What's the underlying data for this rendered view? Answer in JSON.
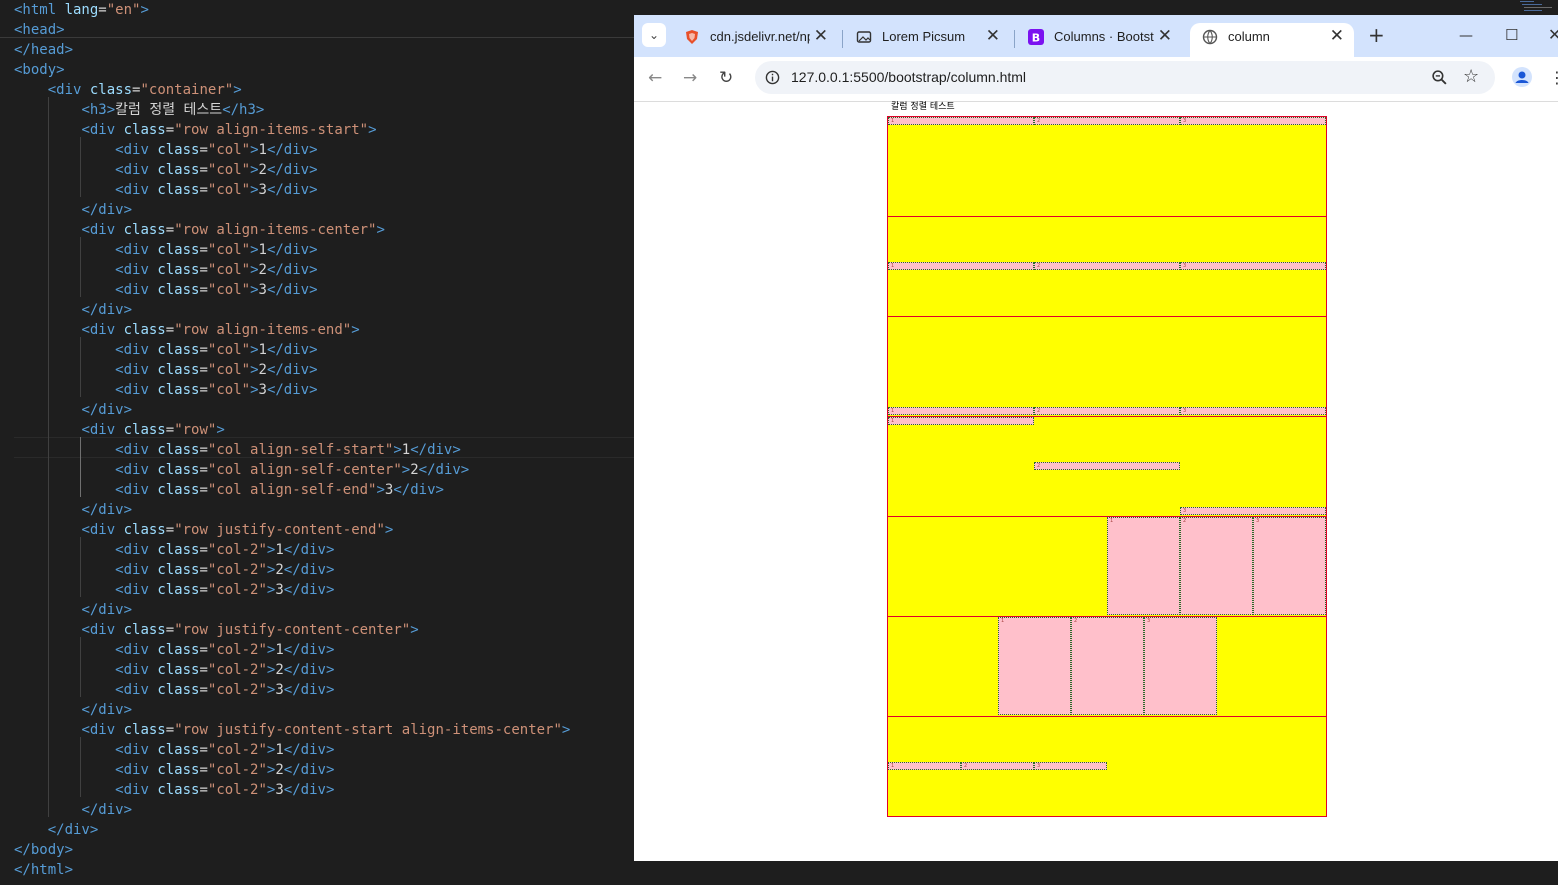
{
  "editor": {
    "lines": [
      [
        [
          "tag",
          "<html "
        ],
        [
          "attr",
          "lang"
        ],
        [
          "txt",
          "="
        ],
        [
          "str",
          "\"en\""
        ],
        [
          "tag",
          ">"
        ]
      ],
      [
        [
          "tag",
          "<head>"
        ]
      ],
      [
        [
          "tag",
          "</head>"
        ]
      ],
      [
        [
          "tag",
          "<body>"
        ]
      ],
      [
        [
          "txt",
          "    "
        ],
        [
          "tag",
          "<div "
        ],
        [
          "attr",
          "class"
        ],
        [
          "txt",
          "="
        ],
        [
          "str",
          "\"container\""
        ],
        [
          "tag",
          ">"
        ]
      ],
      [
        [
          "txt",
          "        "
        ],
        [
          "tag",
          "<h3>"
        ],
        [
          "txt",
          "칼럼 정렬 테스트"
        ],
        [
          "tag",
          "</h3>"
        ]
      ],
      [
        [
          "txt",
          "        "
        ],
        [
          "tag",
          "<div "
        ],
        [
          "attr",
          "class"
        ],
        [
          "txt",
          "="
        ],
        [
          "str",
          "\"row align-items-start\""
        ],
        [
          "tag",
          ">"
        ]
      ],
      [
        [
          "txt",
          "            "
        ],
        [
          "tag",
          "<div "
        ],
        [
          "attr",
          "class"
        ],
        [
          "txt",
          "="
        ],
        [
          "str",
          "\"col\""
        ],
        [
          "tag",
          ">"
        ],
        [
          "txt",
          "1"
        ],
        [
          "tag",
          "</div>"
        ]
      ],
      [
        [
          "txt",
          "            "
        ],
        [
          "tag",
          "<div "
        ],
        [
          "attr",
          "class"
        ],
        [
          "txt",
          "="
        ],
        [
          "str",
          "\"col\""
        ],
        [
          "tag",
          ">"
        ],
        [
          "txt",
          "2"
        ],
        [
          "tag",
          "</div>"
        ]
      ],
      [
        [
          "txt",
          "            "
        ],
        [
          "tag",
          "<div "
        ],
        [
          "attr",
          "class"
        ],
        [
          "txt",
          "="
        ],
        [
          "str",
          "\"col\""
        ],
        [
          "tag",
          ">"
        ],
        [
          "txt",
          "3"
        ],
        [
          "tag",
          "</div>"
        ]
      ],
      [
        [
          "txt",
          "        "
        ],
        [
          "tag",
          "</div>"
        ]
      ],
      [
        [
          "txt",
          "        "
        ],
        [
          "tag",
          "<div "
        ],
        [
          "attr",
          "class"
        ],
        [
          "txt",
          "="
        ],
        [
          "str",
          "\"row align-items-center\""
        ],
        [
          "tag",
          ">"
        ]
      ],
      [
        [
          "txt",
          "            "
        ],
        [
          "tag",
          "<div "
        ],
        [
          "attr",
          "class"
        ],
        [
          "txt",
          "="
        ],
        [
          "str",
          "\"col\""
        ],
        [
          "tag",
          ">"
        ],
        [
          "txt",
          "1"
        ],
        [
          "tag",
          "</div>"
        ]
      ],
      [
        [
          "txt",
          "            "
        ],
        [
          "tag",
          "<div "
        ],
        [
          "attr",
          "class"
        ],
        [
          "txt",
          "="
        ],
        [
          "str",
          "\"col\""
        ],
        [
          "tag",
          ">"
        ],
        [
          "txt",
          "2"
        ],
        [
          "tag",
          "</div>"
        ]
      ],
      [
        [
          "txt",
          "            "
        ],
        [
          "tag",
          "<div "
        ],
        [
          "attr",
          "class"
        ],
        [
          "txt",
          "="
        ],
        [
          "str",
          "\"col\""
        ],
        [
          "tag",
          ">"
        ],
        [
          "txt",
          "3"
        ],
        [
          "tag",
          "</div>"
        ]
      ],
      [
        [
          "txt",
          "        "
        ],
        [
          "tag",
          "</div>"
        ]
      ],
      [
        [
          "txt",
          "        "
        ],
        [
          "tag",
          "<div "
        ],
        [
          "attr",
          "class"
        ],
        [
          "txt",
          "="
        ],
        [
          "str",
          "\"row align-items-end\""
        ],
        [
          "tag",
          ">"
        ]
      ],
      [
        [
          "txt",
          "            "
        ],
        [
          "tag",
          "<div "
        ],
        [
          "attr",
          "class"
        ],
        [
          "txt",
          "="
        ],
        [
          "str",
          "\"col\""
        ],
        [
          "tag",
          ">"
        ],
        [
          "txt",
          "1"
        ],
        [
          "tag",
          "</div>"
        ]
      ],
      [
        [
          "txt",
          "            "
        ],
        [
          "tag",
          "<div "
        ],
        [
          "attr",
          "class"
        ],
        [
          "txt",
          "="
        ],
        [
          "str",
          "\"col\""
        ],
        [
          "tag",
          ">"
        ],
        [
          "txt",
          "2"
        ],
        [
          "tag",
          "</div>"
        ]
      ],
      [
        [
          "txt",
          "            "
        ],
        [
          "tag",
          "<div "
        ],
        [
          "attr",
          "class"
        ],
        [
          "txt",
          "="
        ],
        [
          "str",
          "\"col\""
        ],
        [
          "tag",
          ">"
        ],
        [
          "txt",
          "3"
        ],
        [
          "tag",
          "</div>"
        ]
      ],
      [
        [
          "txt",
          "        "
        ],
        [
          "tag",
          "</div>"
        ]
      ],
      [
        [
          "txt",
          "        "
        ],
        [
          "tag",
          "<div "
        ],
        [
          "attr",
          "class"
        ],
        [
          "txt",
          "="
        ],
        [
          "str",
          "\"row\""
        ],
        [
          "tag",
          ">"
        ]
      ],
      [
        [
          "txt",
          "            "
        ],
        [
          "tag",
          "<div "
        ],
        [
          "attr",
          "class"
        ],
        [
          "txt",
          "="
        ],
        [
          "str",
          "\"col align-self-start\""
        ],
        [
          "tag",
          ">"
        ],
        [
          "txt",
          "1"
        ],
        [
          "tag",
          "</div>"
        ]
      ],
      [
        [
          "txt",
          "            "
        ],
        [
          "tag",
          "<div "
        ],
        [
          "attr",
          "class"
        ],
        [
          "txt",
          "="
        ],
        [
          "str",
          "\"col align-self-center\""
        ],
        [
          "tag",
          ">"
        ],
        [
          "txt",
          "2"
        ],
        [
          "tag",
          "</div>"
        ]
      ],
      [
        [
          "txt",
          "            "
        ],
        [
          "tag",
          "<div "
        ],
        [
          "attr",
          "class"
        ],
        [
          "txt",
          "="
        ],
        [
          "str",
          "\"col align-self-end\""
        ],
        [
          "tag",
          ">"
        ],
        [
          "txt",
          "3"
        ],
        [
          "tag",
          "</div>"
        ]
      ],
      [
        [
          "txt",
          "        "
        ],
        [
          "tag",
          "</div>"
        ]
      ],
      [
        [
          "txt",
          "        "
        ],
        [
          "tag",
          "<div "
        ],
        [
          "attr",
          "class"
        ],
        [
          "txt",
          "="
        ],
        [
          "str",
          "\"row justify-content-end\""
        ],
        [
          "tag",
          ">"
        ]
      ],
      [
        [
          "txt",
          "            "
        ],
        [
          "tag",
          "<div "
        ],
        [
          "attr",
          "class"
        ],
        [
          "txt",
          "="
        ],
        [
          "str",
          "\"col-2\""
        ],
        [
          "tag",
          ">"
        ],
        [
          "txt",
          "1"
        ],
        [
          "tag",
          "</div>"
        ]
      ],
      [
        [
          "txt",
          "            "
        ],
        [
          "tag",
          "<div "
        ],
        [
          "attr",
          "class"
        ],
        [
          "txt",
          "="
        ],
        [
          "str",
          "\"col-2\""
        ],
        [
          "tag",
          ">"
        ],
        [
          "txt",
          "2"
        ],
        [
          "tag",
          "</div>"
        ]
      ],
      [
        [
          "txt",
          "            "
        ],
        [
          "tag",
          "<div "
        ],
        [
          "attr",
          "class"
        ],
        [
          "txt",
          "="
        ],
        [
          "str",
          "\"col-2\""
        ],
        [
          "tag",
          ">"
        ],
        [
          "txt",
          "3"
        ],
        [
          "tag",
          "</div>"
        ]
      ],
      [
        [
          "txt",
          "        "
        ],
        [
          "tag",
          "</div>"
        ]
      ],
      [
        [
          "txt",
          "        "
        ],
        [
          "tag",
          "<div "
        ],
        [
          "attr",
          "class"
        ],
        [
          "txt",
          "="
        ],
        [
          "str",
          "\"row justify-content-center\""
        ],
        [
          "tag",
          ">"
        ]
      ],
      [
        [
          "txt",
          "            "
        ],
        [
          "tag",
          "<div "
        ],
        [
          "attr",
          "class"
        ],
        [
          "txt",
          "="
        ],
        [
          "str",
          "\"col-2\""
        ],
        [
          "tag",
          ">"
        ],
        [
          "txt",
          "1"
        ],
        [
          "tag",
          "</div>"
        ]
      ],
      [
        [
          "txt",
          "            "
        ],
        [
          "tag",
          "<div "
        ],
        [
          "attr",
          "class"
        ],
        [
          "txt",
          "="
        ],
        [
          "str",
          "\"col-2\""
        ],
        [
          "tag",
          ">"
        ],
        [
          "txt",
          "2"
        ],
        [
          "tag",
          "</div>"
        ]
      ],
      [
        [
          "txt",
          "            "
        ],
        [
          "tag",
          "<div "
        ],
        [
          "attr",
          "class"
        ],
        [
          "txt",
          "="
        ],
        [
          "str",
          "\"col-2\""
        ],
        [
          "tag",
          ">"
        ],
        [
          "txt",
          "3"
        ],
        [
          "tag",
          "</div>"
        ]
      ],
      [
        [
          "txt",
          "        "
        ],
        [
          "tag",
          "</div>"
        ]
      ],
      [
        [
          "txt",
          "        "
        ],
        [
          "tag",
          "<div "
        ],
        [
          "attr",
          "class"
        ],
        [
          "txt",
          "="
        ],
        [
          "str",
          "\"row justify-content-start align-items-center\""
        ],
        [
          "tag",
          ">"
        ]
      ],
      [
        [
          "txt",
          "            "
        ],
        [
          "tag",
          "<div "
        ],
        [
          "attr",
          "class"
        ],
        [
          "txt",
          "="
        ],
        [
          "str",
          "\"col-2\""
        ],
        [
          "tag",
          ">"
        ],
        [
          "txt",
          "1"
        ],
        [
          "tag",
          "</div>"
        ]
      ],
      [
        [
          "txt",
          "            "
        ],
        [
          "tag",
          "<div "
        ],
        [
          "attr",
          "class"
        ],
        [
          "txt",
          "="
        ],
        [
          "str",
          "\"col-2\""
        ],
        [
          "tag",
          ">"
        ],
        [
          "txt",
          "2"
        ],
        [
          "tag",
          "</div>"
        ]
      ],
      [
        [
          "txt",
          "            "
        ],
        [
          "tag",
          "<div "
        ],
        [
          "attr",
          "class"
        ],
        [
          "txt",
          "="
        ],
        [
          "str",
          "\"col-2\""
        ],
        [
          "tag",
          ">"
        ],
        [
          "txt",
          "3"
        ],
        [
          "tag",
          "</div>"
        ]
      ],
      [
        [
          "txt",
          "        "
        ],
        [
          "tag",
          "</div>"
        ]
      ],
      [
        [
          "txt",
          "    "
        ],
        [
          "tag",
          "</div>"
        ]
      ],
      [
        [
          "tag",
          "</body>"
        ]
      ],
      [
        [
          "tag",
          "</html>"
        ]
      ]
    ]
  },
  "browser": {
    "tabs": [
      {
        "title": "cdn.jsdelivr.net/npm",
        "icon": "shield-icon",
        "close": "✕"
      },
      {
        "title": "Lorem Picsum",
        "icon": "image-icon",
        "close": "✕"
      },
      {
        "title": "Columns · Bootstrap",
        "icon": "bootstrap-icon",
        "close": "✕"
      },
      {
        "title": "column",
        "icon": "globe-icon",
        "close": "✕"
      }
    ],
    "active_tab": 3,
    "new_tab": "+",
    "url": "127.0.0.1:5500/bootstrap/column.html",
    "window_controls": {
      "minimize": "—",
      "maximize": "☐",
      "close": "✕"
    }
  },
  "page": {
    "heading": "칼럼 정렬 테스트",
    "rows": [
      {
        "name": "row-align-items-start",
        "cols": [
          "1",
          "2",
          "3"
        ]
      },
      {
        "name": "row-align-items-center",
        "cols": [
          "1",
          "2",
          "3"
        ]
      },
      {
        "name": "row-align-items-end",
        "cols": [
          "1",
          "2",
          "3"
        ]
      },
      {
        "name": "row-align-self",
        "cols": [
          "1",
          "2",
          "3"
        ]
      },
      {
        "name": "row-justify-content-end",
        "cols": [
          "1",
          "2",
          "3"
        ]
      },
      {
        "name": "row-justify-content-center",
        "cols": [
          "1",
          "2",
          "3"
        ]
      },
      {
        "name": "row-justify-content-start-align-items-center",
        "cols": [
          "1",
          "2",
          "3"
        ]
      }
    ],
    "colors": {
      "row_bg": "#ffff00",
      "row_border": "#e0002a",
      "col_bg": "#ffc0cb"
    }
  }
}
